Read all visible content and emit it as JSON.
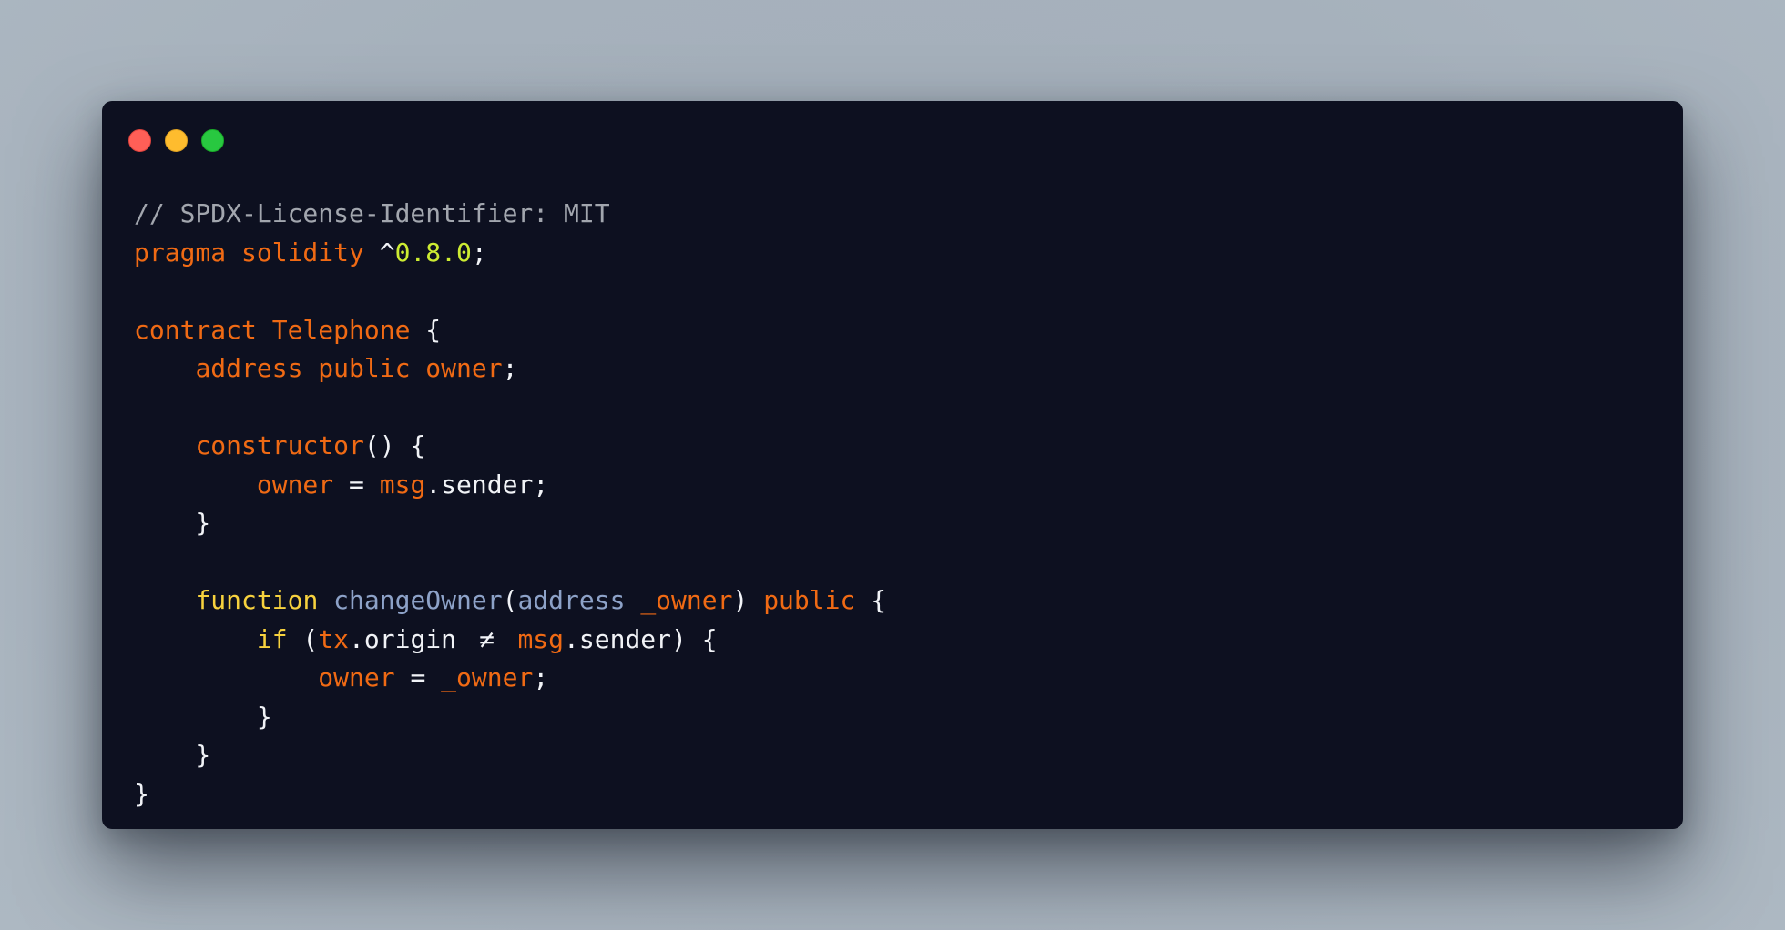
{
  "window": {
    "controls": [
      {
        "name": "close",
        "color": "#ff5f57"
      },
      {
        "name": "minimize",
        "color": "#febc2e"
      },
      {
        "name": "maximize",
        "color": "#28c840"
      }
    ]
  },
  "code": {
    "language": "solidity",
    "colors": {
      "background": "#0d1020",
      "comment": "#a2a6ae",
      "keyword": "#f06a14",
      "plain": "#f1f3f7",
      "version": "#cdec32",
      "control": "#f7d23e",
      "function_name": "#8da2c8"
    },
    "lines": [
      [
        {
          "t": "// SPDX-License-Identifier: MIT",
          "c": "comment"
        }
      ],
      [
        {
          "t": "pragma solidity ",
          "c": "orange"
        },
        {
          "t": "^",
          "c": "plain"
        },
        {
          "t": "0.8.0",
          "c": "version"
        },
        {
          "t": ";",
          "c": "plain"
        }
      ],
      [],
      [
        {
          "t": "contract Telephone ",
          "c": "orange"
        },
        {
          "t": "{",
          "c": "plain"
        }
      ],
      [
        {
          "t": "    ",
          "c": "plain"
        },
        {
          "t": "address public owner",
          "c": "orange"
        },
        {
          "t": ";",
          "c": "plain"
        }
      ],
      [],
      [
        {
          "t": "    ",
          "c": "plain"
        },
        {
          "t": "constructor",
          "c": "orange"
        },
        {
          "t": "() {",
          "c": "plain"
        }
      ],
      [
        {
          "t": "        ",
          "c": "plain"
        },
        {
          "t": "owner",
          "c": "orange"
        },
        {
          "t": " = ",
          "c": "plain"
        },
        {
          "t": "msg",
          "c": "orange"
        },
        {
          "t": ".sender;",
          "c": "plain"
        }
      ],
      [
        {
          "t": "    }",
          "c": "plain"
        }
      ],
      [],
      [
        {
          "t": "    ",
          "c": "plain"
        },
        {
          "t": "function",
          "c": "yellow"
        },
        {
          "t": " ",
          "c": "plain"
        },
        {
          "t": "changeOwner",
          "c": "blue"
        },
        {
          "t": "(",
          "c": "plain"
        },
        {
          "t": "address",
          "c": "blue"
        },
        {
          "t": " ",
          "c": "plain"
        },
        {
          "t": "_owner",
          "c": "orange"
        },
        {
          "t": ") ",
          "c": "plain"
        },
        {
          "t": "public",
          "c": "orange"
        },
        {
          "t": " {",
          "c": "plain"
        }
      ],
      [
        {
          "t": "        ",
          "c": "plain"
        },
        {
          "t": "if",
          "c": "yellow"
        },
        {
          "t": " (",
          "c": "plain"
        },
        {
          "t": "tx",
          "c": "orange"
        },
        {
          "t": ".origin ",
          "c": "plain"
        },
        {
          "t": "≠",
          "c": "plain",
          "lig": true
        },
        {
          "t": " ",
          "c": "plain"
        },
        {
          "t": "msg",
          "c": "orange"
        },
        {
          "t": ".sender) {",
          "c": "plain"
        }
      ],
      [
        {
          "t": "            ",
          "c": "plain"
        },
        {
          "t": "owner",
          "c": "orange"
        },
        {
          "t": " = ",
          "c": "plain"
        },
        {
          "t": "_owner",
          "c": "orange"
        },
        {
          "t": ";",
          "c": "plain"
        }
      ],
      [
        {
          "t": "        }",
          "c": "plain"
        }
      ],
      [
        {
          "t": "    }",
          "c": "plain"
        }
      ],
      [
        {
          "t": "}",
          "c": "plain"
        }
      ]
    ]
  }
}
